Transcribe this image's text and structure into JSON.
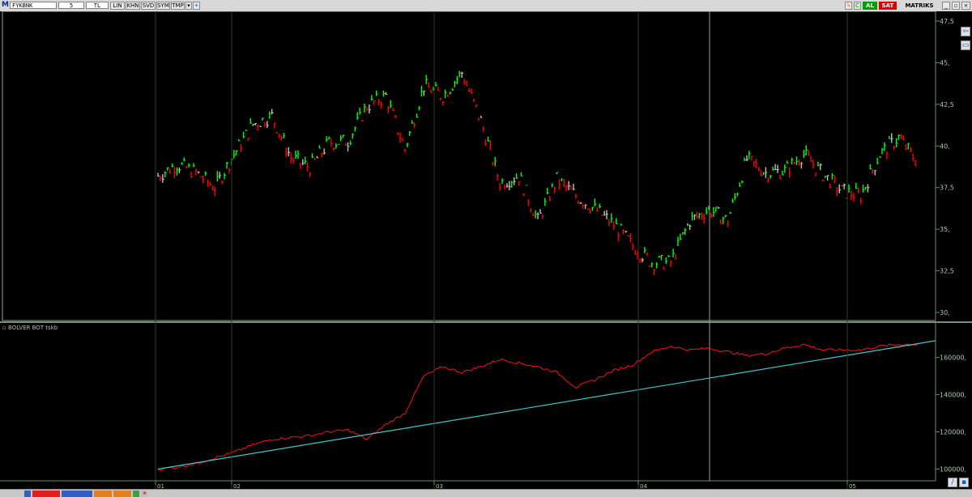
{
  "toolbar": {
    "logo": "M",
    "symbol": "FYKBNK",
    "period": "5",
    "currency": "TL",
    "buttons": [
      "LIN",
      "KHN",
      "SVD",
      "SYM",
      "TMP"
    ],
    "buy_label": "AL",
    "sell_label": "SAT",
    "brand": "MATRIKS",
    "colors": {
      "buy": "#00a000",
      "sell": "#e00000"
    }
  },
  "price_panel": {
    "y_ticks": [
      "47,5",
      "45,",
      "42,5",
      "40,",
      "37,5",
      "35,",
      "32,5",
      "30,"
    ]
  },
  "indicator_panel": {
    "label": "BOLVER BOT tskb",
    "y_ticks": [
      "160000,",
      "140000,",
      "120000,",
      "100000,"
    ]
  },
  "x_ticks": [
    "01",
    "02",
    "03",
    "04",
    "05"
  ],
  "chart_data": [
    {
      "type": "line",
      "title": "",
      "x": [
        0,
        3,
        6,
        9,
        12,
        15,
        18,
        21,
        24,
        27,
        30,
        33,
        36,
        39,
        42,
        45,
        48,
        51,
        54,
        57,
        60,
        63,
        66,
        69,
        72,
        75,
        78,
        81,
        84,
        87,
        90,
        93,
        96,
        99,
        102,
        105,
        108,
        111,
        114,
        117,
        120
      ],
      "series": [
        {
          "name": "",
          "values": [
            38.2,
            38.9,
            38.4,
            37.5,
            39.5,
            41.3,
            41.8,
            39.3,
            38.7,
            40.2,
            40.3,
            42.4,
            43.0,
            39.8,
            43.6,
            43.0,
            44.4,
            41.5,
            37.8,
            38.2,
            35.5,
            38.0,
            37.0,
            36.2,
            35.3,
            34.0,
            33.0,
            33.0,
            35.5,
            36.2,
            35.5,
            39.2,
            38.4,
            38.5,
            39.5,
            38.3,
            37.3,
            37.0,
            39.5,
            40.5,
            39.0
          ]
        }
      ],
      "ylim": [
        29,
        48
      ],
      "colors": {
        "up": "#00ff00",
        "down": "#ff0000",
        "flat": "#c0c0c0"
      }
    },
    {
      "type": "line",
      "title": "",
      "x": [
        0,
        3,
        6,
        9,
        12,
        15,
        18,
        21,
        24,
        27,
        30,
        33,
        36,
        39,
        42,
        45,
        48,
        51,
        54,
        57,
        60,
        63,
        66,
        69,
        72,
        75,
        78,
        81,
        84,
        87,
        90,
        93,
        96,
        99,
        102,
        105,
        108,
        111,
        114,
        117,
        120
      ],
      "series": [
        {
          "name": "",
          "values": [
            100000,
            101000,
            103000,
            106000,
            109000,
            113000,
            116000,
            117000,
            118000,
            120000,
            121000,
            116000,
            124000,
            130000,
            150000,
            155000,
            152000,
            155000,
            159000,
            157000,
            155000,
            152000,
            144000,
            148000,
            153000,
            156000,
            163000,
            166000,
            164000,
            165000,
            163000,
            161000,
            162000,
            165000,
            167000,
            164000,
            164000,
            164000,
            166000,
            167000,
            167000
          ]
        }
      ],
      "trendline": {
        "start": 100000,
        "end": 169000
      },
      "ylim": [
        95000,
        172000
      ],
      "colors": {
        "equity": "#ff1010",
        "trend": "#40c8d0"
      }
    }
  ]
}
